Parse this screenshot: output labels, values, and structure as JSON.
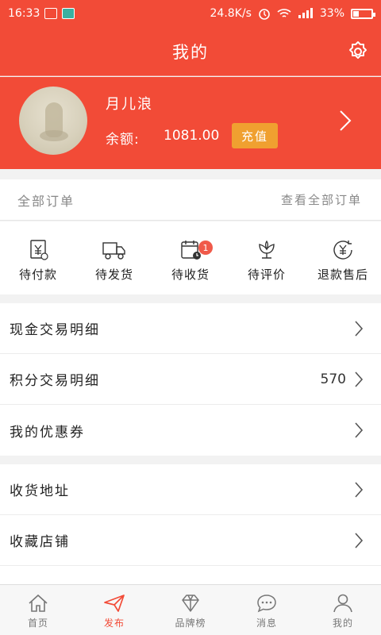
{
  "status_bar": {
    "time": "16:33",
    "network_speed": "24.8K/s",
    "battery": "33%",
    "battery_level": 0.33
  },
  "header": {
    "title": "我的"
  },
  "profile": {
    "username": "月儿浪",
    "balance_label": "余额:",
    "balance": "1081.00",
    "recharge_label": "充值"
  },
  "orders": {
    "title": "全部订单",
    "view_all": "查看全部订单",
    "items": [
      {
        "label": "待付款",
        "icon": "payment-icon"
      },
      {
        "label": "待发货",
        "icon": "truck-icon"
      },
      {
        "label": "待收货",
        "icon": "calendar-clock-icon",
        "badge": "1"
      },
      {
        "label": "待评价",
        "icon": "flower-icon"
      },
      {
        "label": "退款售后",
        "icon": "refund-icon"
      }
    ]
  },
  "menu_group_1": [
    {
      "label": "现金交易明细"
    },
    {
      "label": "积分交易明细",
      "value": "570"
    },
    {
      "label": "我的优惠券"
    }
  ],
  "menu_group_2": [
    {
      "label": "收货地址"
    },
    {
      "label": "收藏店铺"
    }
  ],
  "tabbar": [
    {
      "label": "首页",
      "icon": "home-icon"
    },
    {
      "label": "发布",
      "icon": "send-icon",
      "active": true
    },
    {
      "label": "品牌榜",
      "icon": "diamond-icon"
    },
    {
      "label": "消息",
      "icon": "message-icon"
    },
    {
      "label": "我的",
      "icon": "user-icon"
    }
  ],
  "colors": {
    "brand": "#f24b37",
    "recharge": "#f0a030",
    "badge": "#f05a4a"
  }
}
